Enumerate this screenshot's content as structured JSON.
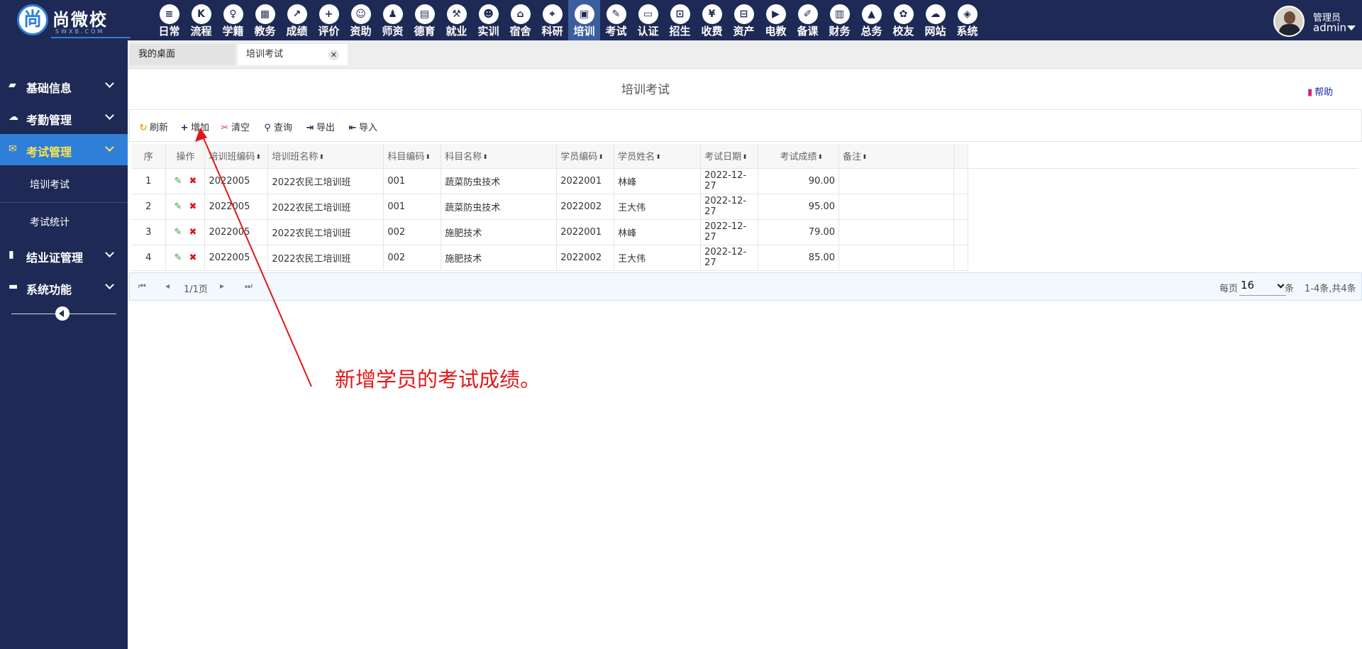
{
  "brand": {
    "name": "尚微校",
    "sub": "SWXB.COM",
    "mark": "尚"
  },
  "modules": [
    {
      "label": "日常",
      "icon": "≡"
    },
    {
      "label": "流程",
      "icon": "K"
    },
    {
      "label": "学籍",
      "icon": "♀"
    },
    {
      "label": "教务",
      "icon": "▦"
    },
    {
      "label": "成绩",
      "icon": "↗"
    },
    {
      "label": "评价",
      "icon": "+"
    },
    {
      "label": "资助",
      "icon": "☺"
    },
    {
      "label": "师资",
      "icon": "♟"
    },
    {
      "label": "德育",
      "icon": "▤"
    },
    {
      "label": "就业",
      "icon": "⚒"
    },
    {
      "label": "实训",
      "icon": "☻"
    },
    {
      "label": "宿舍",
      "icon": "⌂"
    },
    {
      "label": "科研",
      "icon": "⌖"
    },
    {
      "label": "培训",
      "icon": "▣"
    },
    {
      "label": "考试",
      "icon": "✎"
    },
    {
      "label": "认证",
      "icon": "▭"
    },
    {
      "label": "招生",
      "icon": "⊡"
    },
    {
      "label": "收费",
      "icon": "¥"
    },
    {
      "label": "资产",
      "icon": "⊟"
    },
    {
      "label": "电教",
      "icon": "▶"
    },
    {
      "label": "备课",
      "icon": "✐"
    },
    {
      "label": "财务",
      "icon": "▥"
    },
    {
      "label": "总务",
      "icon": "▲"
    },
    {
      "label": "校友",
      "icon": "✿"
    },
    {
      "label": "网站",
      "icon": "☁"
    },
    {
      "label": "系统",
      "icon": "◈"
    }
  ],
  "active_module": "培训",
  "user": {
    "role": "管理员",
    "name": "admin"
  },
  "sidebar": {
    "groups": [
      {
        "label": "基础信息",
        "icon": "▰"
      },
      {
        "label": "考勤管理",
        "icon": "☁"
      },
      {
        "label": "考试管理",
        "icon": "✉"
      },
      {
        "label": "结业证管理",
        "icon": "▮"
      },
      {
        "label": "系统功能",
        "icon": "▬"
      }
    ],
    "subitems": [
      "培训考试",
      "考试统计"
    ]
  },
  "tabs": [
    {
      "label": "我的桌面"
    },
    {
      "label": "培训考试",
      "close": "✕"
    }
  ],
  "page": {
    "title": "培训考试",
    "help": "帮助"
  },
  "toolbar": [
    {
      "label": "刷新",
      "icon": "↻",
      "color": "#f0a020"
    },
    {
      "label": "增加",
      "icon": "+",
      "color": "#1a2a5a"
    },
    {
      "label": "清空",
      "icon": "✂",
      "color": "#d4237a"
    },
    {
      "label": "查询",
      "icon": "⚲",
      "color": "#1a2a5a"
    },
    {
      "label": "导出",
      "icon": "⇥",
      "color": "#1a2a5a"
    },
    {
      "label": "导入",
      "icon": "⇤",
      "color": "#1a2a5a"
    }
  ],
  "table": {
    "columns": [
      "序",
      "操作",
      "培训班编码",
      "培训班名称",
      "科目编码",
      "科目名称",
      "学员编码",
      "学员姓名",
      "考试日期",
      "考试成绩",
      "备注"
    ],
    "sort_icon": "⬍",
    "edit_icon": "✎",
    "delete_icon": "✖",
    "rows": [
      [
        "1",
        "2022005",
        "2022农民工培训班",
        "001",
        "蔬菜防虫技术",
        "2022001",
        "林峰",
        "2022-12-27",
        "90.00",
        ""
      ],
      [
        "2",
        "2022005",
        "2022农民工培训班",
        "001",
        "蔬菜防虫技术",
        "2022002",
        "王大伟",
        "2022-12-27",
        "95.00",
        ""
      ],
      [
        "3",
        "2022005",
        "2022农民工培训班",
        "002",
        "施肥技术",
        "2022001",
        "林峰",
        "2022-12-27",
        "79.00",
        ""
      ],
      [
        "4",
        "2022005",
        "2022农民工培训班",
        "002",
        "施肥技术",
        "2022002",
        "王大伟",
        "2022-12-27",
        "85.00",
        ""
      ]
    ]
  },
  "pager": {
    "first_icon": "⏮",
    "prev_icon": "◂",
    "next_icon": "▸",
    "last_icon": "⏭",
    "page_info": "1/1页",
    "per_page_label": "每页",
    "per_page_value": "16",
    "per_page_unit": "条",
    "records": "1-4条,共4条"
  },
  "annotation": {
    "text": "新增学员的考试成绩。",
    "color": "#e01818"
  },
  "colors": {
    "topbar": "#1e2a55",
    "sidebar": "#1e2a55",
    "sidebar_active": "#2f7fd9",
    "active_text": "#ffe44d"
  }
}
